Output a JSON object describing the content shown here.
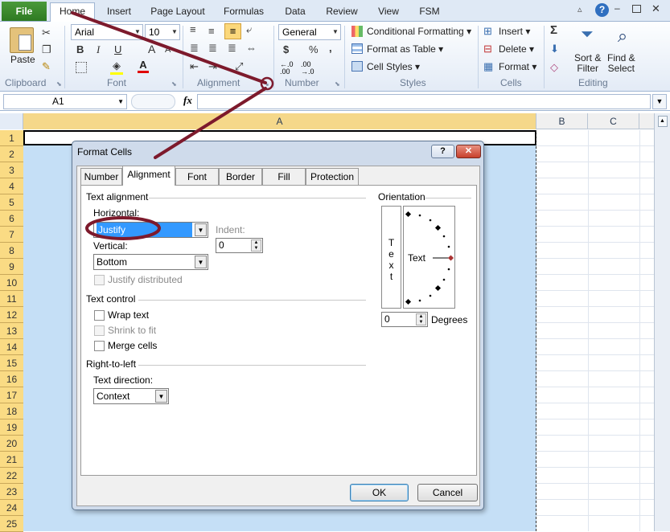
{
  "ribbon_tabs": {
    "file": "File",
    "home": "Home",
    "insert": "Insert",
    "page_layout": "Page Layout",
    "formulas": "Formulas",
    "data": "Data",
    "review": "Review",
    "view": "View",
    "fsm": "FSM"
  },
  "clipboard": {
    "paste": "Paste",
    "label": "Clipboard"
  },
  "font": {
    "name": "Arial",
    "size": "10",
    "bold": "B",
    "italic": "I",
    "underline": "U",
    "grow": "A",
    "shrink": "A",
    "font_color": "A",
    "label": "Font"
  },
  "alignment": {
    "label": "Alignment"
  },
  "number": {
    "format": "General",
    "currency": "$",
    "percent": "%",
    "comma": ",",
    "inc": "←.0 .00",
    "dec": ".00 →.0",
    "label": "Number"
  },
  "styles": {
    "conditional": "Conditional Formatting",
    "table": "Format as Table",
    "cell_styles": "Cell Styles",
    "label": "Styles"
  },
  "cells": {
    "insert": "Insert",
    "delete": "Delete",
    "format": "Format",
    "label": "Cells"
  },
  "editing": {
    "sum": "Σ",
    "sort_1": "Sort &",
    "sort_2": "Filter",
    "find_1": "Find &",
    "find_2": "Select",
    "label": "Editing"
  },
  "formula_bar": {
    "name_box": "A1",
    "fx": "fx",
    "value": ""
  },
  "columns": [
    "A",
    "B",
    "C"
  ],
  "rows": [
    "1",
    "2",
    "3",
    "4",
    "5",
    "6",
    "7",
    "8",
    "9",
    "10",
    "11",
    "12",
    "13",
    "14",
    "15",
    "16",
    "17",
    "18",
    "19",
    "20",
    "21",
    "22",
    "23",
    "24",
    "25"
  ],
  "dialog": {
    "title": "Format Cells",
    "help": "?",
    "close": "✕",
    "tabs": [
      "Number",
      "Alignment",
      "Font",
      "Border",
      "Fill",
      "Protection"
    ],
    "text_alignment": "Text alignment",
    "horizontal_label": "Horizontal:",
    "horizontal_value": "Justify",
    "indent_label": "Indent:",
    "indent_value": "0",
    "vertical_label": "Vertical:",
    "vertical_value": "Bottom",
    "justify_distributed": "Justify distributed",
    "text_control": "Text control",
    "wrap_text": "Wrap text",
    "shrink_to_fit": "Shrink to fit",
    "merge_cells": "Merge cells",
    "rtl": "Right-to-left",
    "text_direction_label": "Text direction:",
    "text_direction_value": "Context",
    "orientation": "Orientation",
    "vertical_text": [
      "T",
      "e",
      "x",
      "t"
    ],
    "orientation_text": "Text",
    "degrees_value": "0",
    "degrees_label": "Degrees",
    "ok": "OK",
    "cancel": "Cancel"
  },
  "colors": {
    "file_tab": "#2e7a22",
    "accent": "#9fb5d2",
    "row_header": "#fadb84",
    "selection": "#c5dff6",
    "annotation": "#7d1a2c"
  }
}
